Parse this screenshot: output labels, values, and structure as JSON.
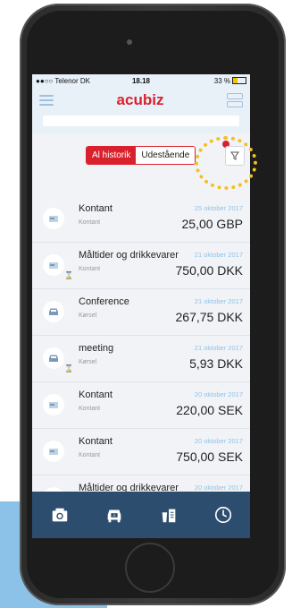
{
  "status": {
    "carrier": "●●○○ Telenor DK",
    "time": "18.18",
    "battery": "33 %",
    "battery_level": 0.33
  },
  "header": {
    "logo": "acubiz"
  },
  "filter": {
    "tab_all": "Al historik",
    "tab_pending": "Udestående"
  },
  "items": [
    {
      "title": "Kontant",
      "category": "Kontant",
      "date": "25 oktober 2017",
      "amount": "25,00 GBP",
      "icon": "cash-icon",
      "pending": false
    },
    {
      "title": "Måltider og drikkevarer",
      "category": "Kontant",
      "date": "21 oktober 2017",
      "amount": "750,00 DKK",
      "icon": "cash-icon",
      "pending": true
    },
    {
      "title": "Conference",
      "category": "Kørsel",
      "date": "21 oktober 2017",
      "amount": "267,75 DKK",
      "icon": "car-icon",
      "pending": false
    },
    {
      "title": "meeting",
      "category": "Kørsel",
      "date": "21 oktober 2017",
      "amount": "5,93 DKK",
      "icon": "car-icon",
      "pending": true
    },
    {
      "title": "Kontant",
      "category": "Kontant",
      "date": "20 oktober 2017",
      "amount": "220,00 SEK",
      "icon": "cash-icon",
      "pending": false
    },
    {
      "title": "Kontant",
      "category": "Kontant",
      "date": "20 oktober 2017",
      "amount": "750,00 SEK",
      "icon": "cash-icon",
      "pending": false
    },
    {
      "title": "Måltider og drikkevarer",
      "category": "",
      "date": "20 oktober 2017",
      "amount": "",
      "icon": "cash-icon",
      "pending": false
    }
  ],
  "tabbar": [
    "camera-icon",
    "car-icon",
    "receipt-icon",
    "clock-icon"
  ],
  "colors": {
    "brand": "#d9212d",
    "tabbar": "#2c4d6d",
    "date": "#8ec3ea",
    "highlight": "#f3c11e"
  }
}
